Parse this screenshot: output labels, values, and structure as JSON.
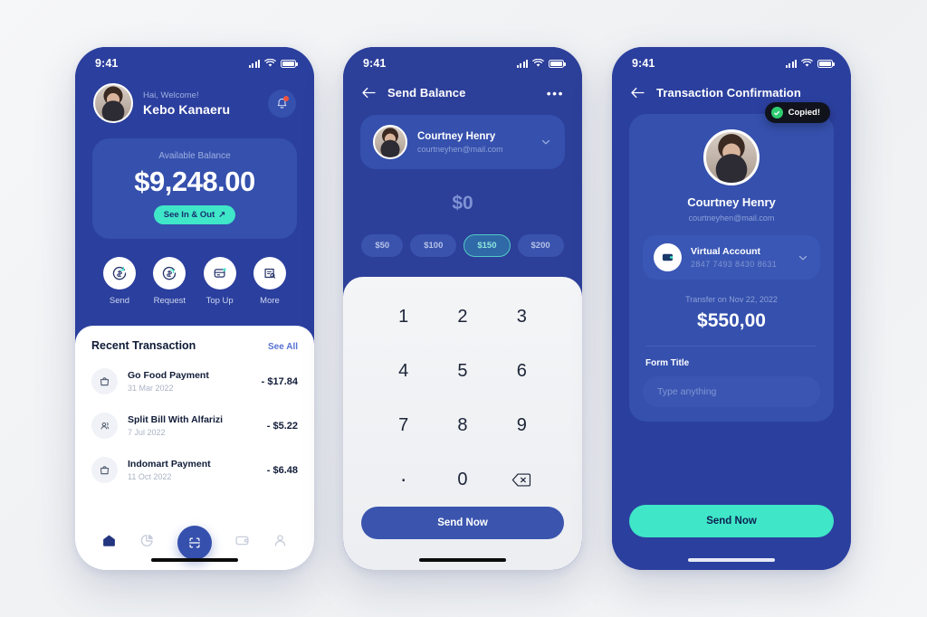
{
  "screens": {
    "home": {
      "status": {
        "time": "9:41"
      },
      "greeting_small": "Hai, Welcome!",
      "user_name": "Kebo Kanaeru",
      "balance": {
        "label": "Available Balance",
        "amount": "$9,248.00",
        "cta": "See In & Out",
        "cta_arrow": "↗"
      },
      "actions": [
        {
          "label": "Send",
          "icon": "send-money-icon"
        },
        {
          "label": "Request",
          "icon": "request-money-icon"
        },
        {
          "label": "Top Up",
          "icon": "top-up-icon"
        },
        {
          "label": "More",
          "icon": "more-options-icon"
        }
      ],
      "transactions": {
        "title": "Recent Transaction",
        "see_all": "See All",
        "items": [
          {
            "name": "Go Food Payment",
            "date": "31 Mar 2022",
            "amount": "- $17.84",
            "icon": "bag-icon"
          },
          {
            "name": "Split Bill With Alfarizi",
            "date": "7 Jul 2022",
            "amount": "- $5.22",
            "icon": "group-icon"
          },
          {
            "name": "Indomart Payment",
            "date": "11 Oct 2022",
            "amount": "- $6.48",
            "icon": "bag-icon"
          }
        ]
      },
      "tabs": [
        {
          "name": "home",
          "active": true
        },
        {
          "name": "statistics",
          "active": false
        },
        {
          "name": "scan",
          "active": false
        },
        {
          "name": "wallet",
          "active": false
        },
        {
          "name": "profile",
          "active": false
        }
      ]
    },
    "send": {
      "status": {
        "time": "9:41"
      },
      "title": "Send Balance",
      "recipient": {
        "name": "Courtney Henry",
        "email": "courtneyhen@mail.com"
      },
      "amount_display": "$0",
      "quick_amounts": [
        {
          "label": "$50",
          "selected": false
        },
        {
          "label": "$100",
          "selected": false
        },
        {
          "label": "$150",
          "selected": true
        },
        {
          "label": "$200",
          "selected": false
        }
      ],
      "keypad": [
        "1",
        "2",
        "3",
        "4",
        "5",
        "6",
        "7",
        "8",
        "9",
        ".",
        "0",
        "⌫"
      ],
      "submit": "Send Now"
    },
    "confirm": {
      "status": {
        "time": "9:41"
      },
      "title": "Transaction Confirmation",
      "recipient": {
        "name": "Courtney Henry",
        "email": "courtneyhen@mail.com"
      },
      "toast": "Copied!",
      "virtual_account": {
        "title": "Virtual Account",
        "number": "2847  7493  8430  8631"
      },
      "transfer_date": "Transfer on Nov 22, 2022",
      "transfer_amount": "$550,00",
      "form": {
        "label": "Form Title",
        "placeholder": "Type anything",
        "value": ""
      },
      "submit": "Send Now"
    }
  },
  "colors": {
    "navy": "#2b3f9e",
    "card_navy": "#3550ad",
    "teal": "#3fe6c8",
    "success": "#2ecc71",
    "page_bg": "#f2f3f5"
  }
}
